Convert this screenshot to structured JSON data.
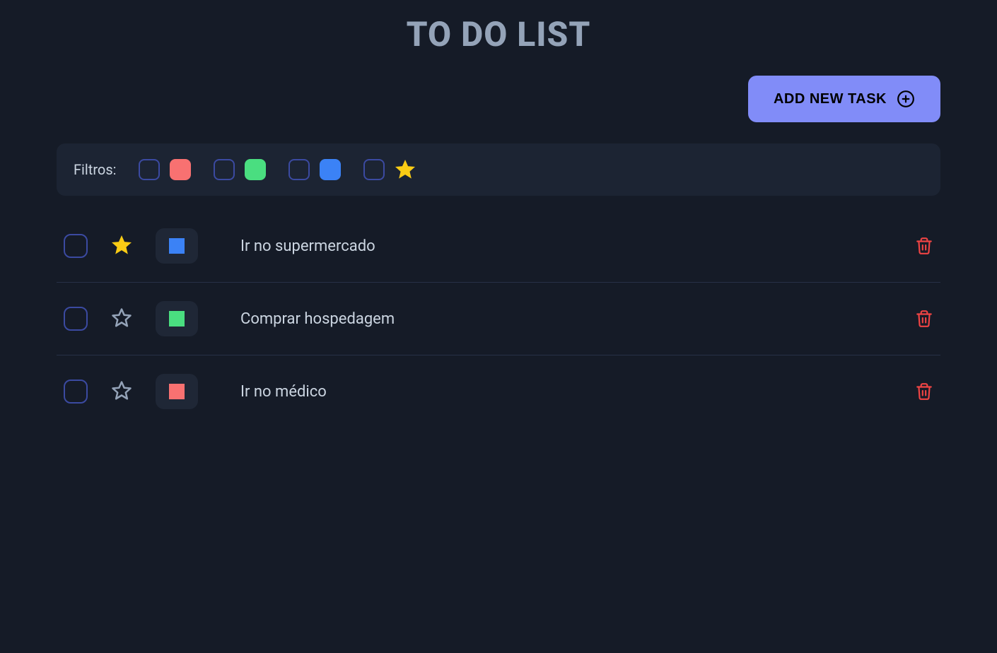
{
  "title": "TO DO LIST",
  "add_button_label": "ADD NEW TASK",
  "filters": {
    "label": "Filtros:",
    "options": [
      {
        "color": "red",
        "checked": false
      },
      {
        "color": "green",
        "checked": false
      },
      {
        "color": "blue",
        "checked": false
      },
      {
        "star": true,
        "checked": false
      }
    ]
  },
  "tasks": [
    {
      "text": "Ir no supermercado",
      "color": "blue",
      "starred": true,
      "done": false
    },
    {
      "text": "Comprar hospedagem",
      "color": "green",
      "starred": false,
      "done": false
    },
    {
      "text": "Ir no médico",
      "color": "red",
      "starred": false,
      "done": false
    }
  ]
}
